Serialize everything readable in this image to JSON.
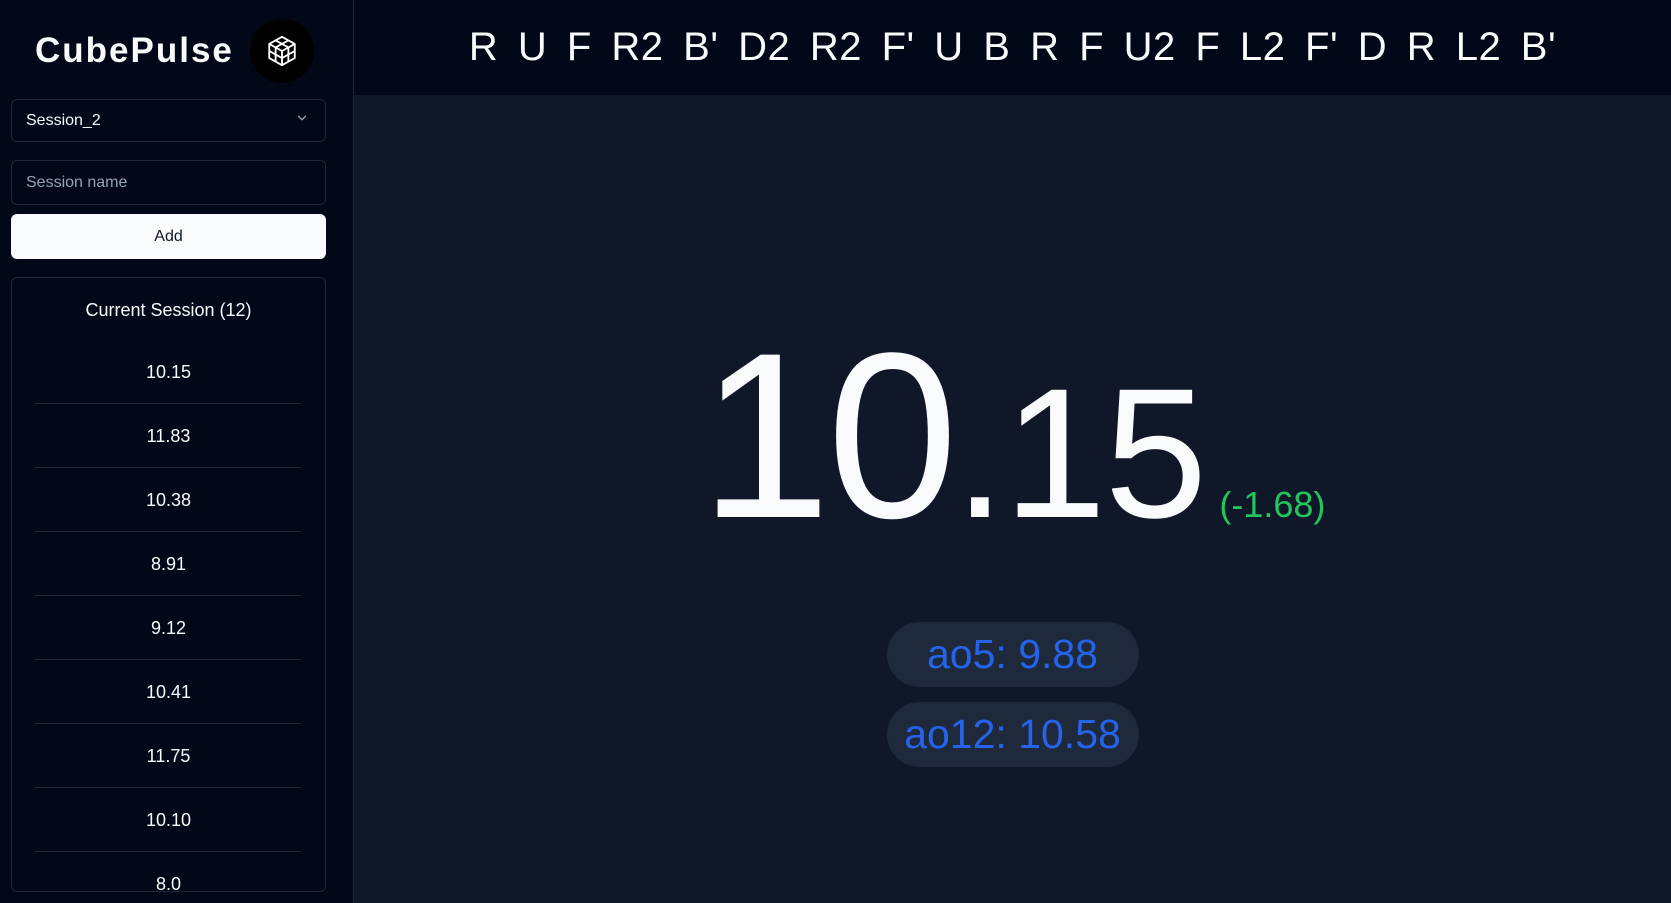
{
  "brand": {
    "name": "CubePulse",
    "logo_icon": "cube-icon"
  },
  "sidebar": {
    "session_select": {
      "value": "Session_2",
      "icon": "chevron-down-icon"
    },
    "session_input": {
      "placeholder": "Session name",
      "value": ""
    },
    "add_label": "Add",
    "times_title": "Current Session (12)",
    "times": [
      "10.15",
      "11.83",
      "10.38",
      "8.91",
      "9.12",
      "10.41",
      "11.75",
      "10.10",
      "8.0"
    ]
  },
  "main": {
    "scramble": "R U F R2 B' D2 R2 F' U B R F U2 F L2 F' D R L2 B'",
    "timer": {
      "whole": "10",
      "decimal": ".15"
    },
    "delta": "(-1.68)",
    "ao5": "ao5: 9.88",
    "ao12": "ao12: 10.58"
  },
  "colors": {
    "background": "#0f1729",
    "sidebar": "#020817",
    "delta_green": "#22c55e",
    "stat_blue": "#2563eb",
    "pill_bg": "#1e293b"
  }
}
